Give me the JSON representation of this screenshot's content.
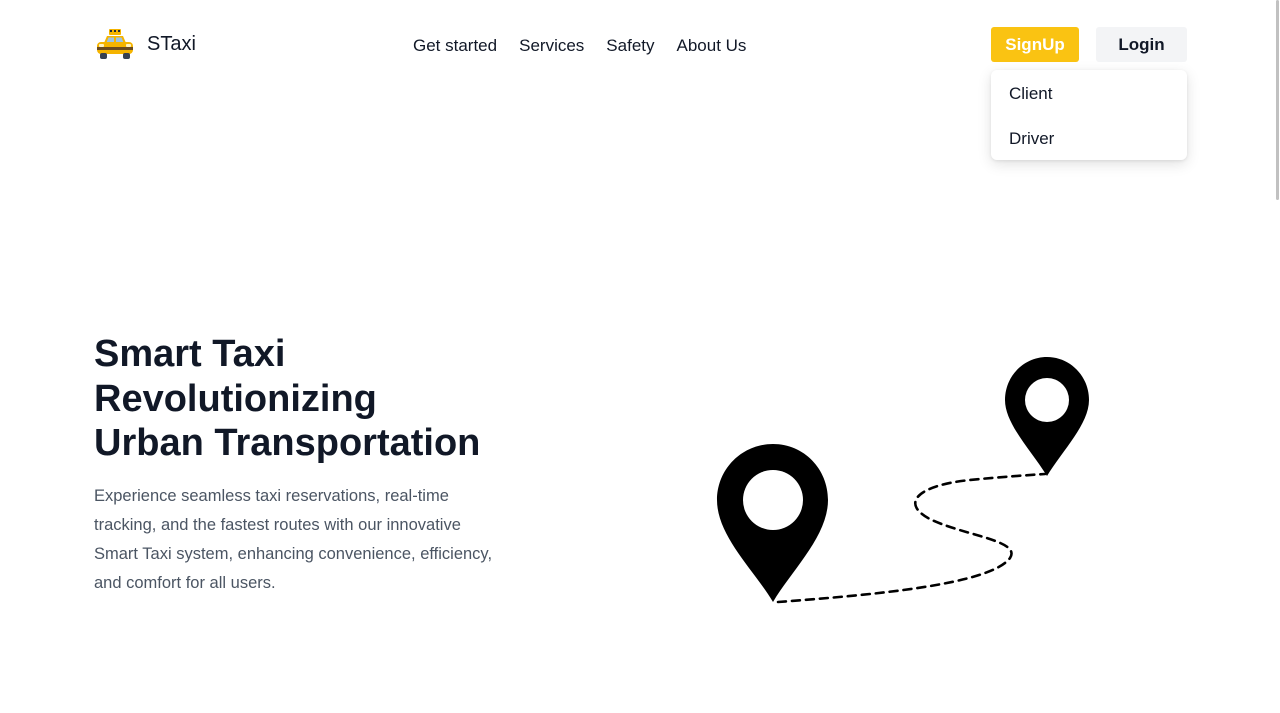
{
  "brand": {
    "name": "STaxi",
    "icon": "taxi-icon"
  },
  "nav": {
    "items": [
      {
        "label": "Get started"
      },
      {
        "label": "Services"
      },
      {
        "label": "Safety"
      },
      {
        "label": "About Us"
      }
    ]
  },
  "auth": {
    "signup_label": "SignUp",
    "login_label": "Login",
    "dropdown": {
      "items": [
        {
          "label": "Client"
        },
        {
          "label": "Driver"
        }
      ]
    }
  },
  "hero": {
    "title_lines": [
      "Smart Taxi",
      "Revolutionizing",
      "Urban Transportation"
    ],
    "description_lines": [
      "Experience seamless taxi reservations, real-time",
      "tracking, and the fastest routes with our innovative",
      "Smart Taxi system, enhancing convenience, efficiency,",
      "and comfort for all users."
    ],
    "illustration": "map-route-pins-icon"
  },
  "colors": {
    "accent": "#fac312",
    "text": "#111827",
    "muted_text": "#4b5563",
    "login_bg": "#f3f4f6"
  }
}
